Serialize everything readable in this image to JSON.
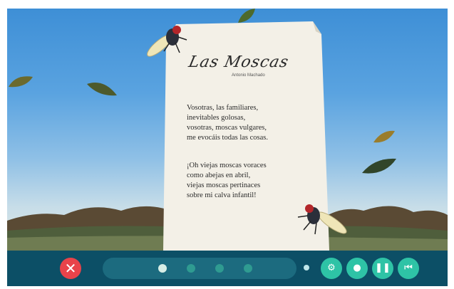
{
  "poem": {
    "title": "Las Moscas",
    "author": "Antonio Machado",
    "stanza1": [
      "Vosotras, las familiares,",
      "inevitables golosas,",
      "vosotras, moscas vulgares,",
      "me evocáis todas las cosas."
    ],
    "stanza2": [
      "¡Oh viejas moscas voraces",
      "como abejas en abril,",
      "viejas moscas pertinaces",
      "sobre mi calva infantil!"
    ]
  },
  "controls": {
    "close_glyph": "✕",
    "page_count": 4,
    "current_page": 1,
    "icons": [
      "settings-icon",
      "microphone-icon",
      "pause-icon",
      "skip-back-icon"
    ]
  },
  "colors": {
    "sky": "#4a98db",
    "control_bar": "#0c4f66",
    "close_button": "#e8434a",
    "control_button": "#2ec3a6",
    "paper": "#f3f0e7"
  }
}
